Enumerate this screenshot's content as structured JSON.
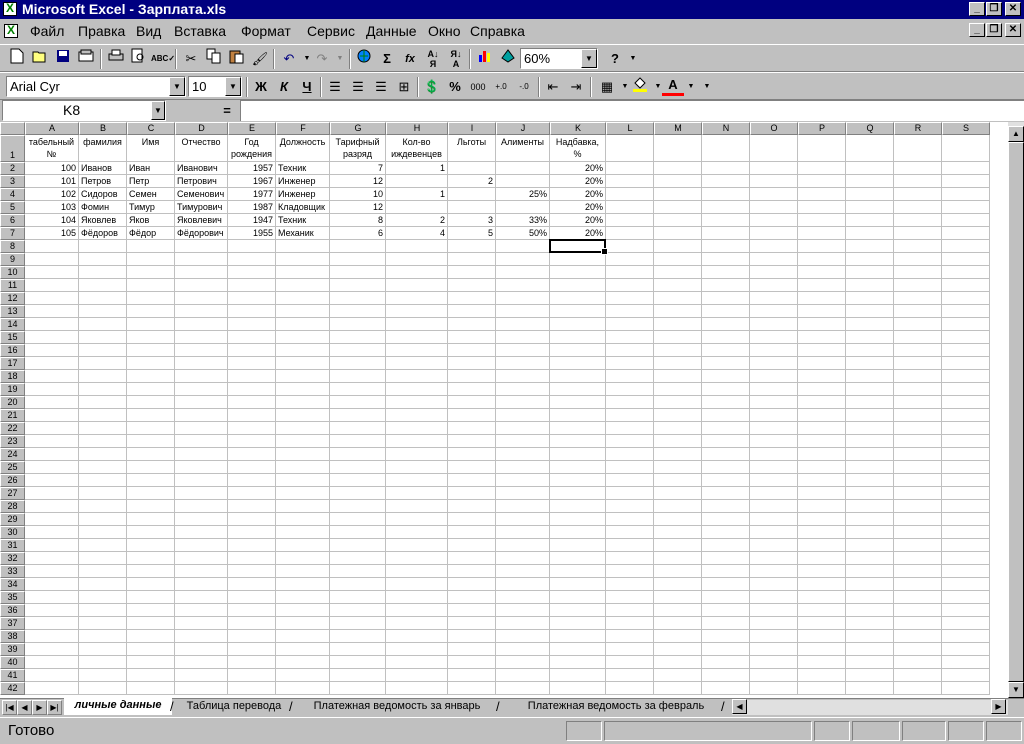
{
  "window": {
    "title": "Microsoft Excel - Зарплата.xls"
  },
  "menu": [
    "Файл",
    "Правка",
    "Вид",
    "Вставка",
    "Формат",
    "Сервис",
    "Данные",
    "Окно",
    "Справка"
  ],
  "toolbar_standard": {
    "zoom": "60%",
    "icons": [
      "new-icon",
      "open-icon",
      "save-icon",
      "print-icon",
      "print-preview-icon",
      "spelling-icon",
      "cut-icon",
      "copy-icon",
      "paste-icon",
      "format-painter-icon",
      "undo-icon",
      "redo-icon",
      "web-icon",
      "autosum-icon",
      "function-icon",
      "sort-asc-icon",
      "sort-desc-icon",
      "chart-wizard-icon",
      "drawing-icon",
      "help-icon"
    ],
    "autosum_glyph": "Σ",
    "function_glyph": "fx"
  },
  "toolbar_format": {
    "font": "Arial Cyr",
    "size": "10",
    "bold": "Ж",
    "italic": "К",
    "underline": "Ч",
    "percent": "%",
    "thousands": "000",
    "font_color_glyph": "A"
  },
  "formula_bar": {
    "cell_ref": "K8",
    "equals": "=",
    "content": ""
  },
  "grid": {
    "columns": [
      "A",
      "B",
      "C",
      "D",
      "E",
      "F",
      "G",
      "H",
      "I",
      "J",
      "K",
      "L",
      "M",
      "N",
      "O",
      "P",
      "Q",
      "R",
      "S"
    ],
    "header_row": [
      "табельный №",
      "фамилия",
      "Имя",
      "Отчество",
      "Год рождения",
      "Должность",
      "Тарифный разряд",
      "Кол-во иждевенцев",
      "Льготы",
      "Алименты",
      "Надбавка, %"
    ],
    "rows": [
      [
        "100",
        "Иванов",
        "Иван",
        "Иванович",
        "1957",
        "Техник",
        "7",
        "1",
        "",
        "",
        "20%"
      ],
      [
        "101",
        "Петров",
        "Петр",
        "Петрович",
        "1967",
        "Инженер",
        "12",
        "",
        "2",
        "",
        "20%"
      ],
      [
        "102",
        "Сидоров",
        "Семен",
        "Семенович",
        "1977",
        "Инженер",
        "10",
        "1",
        "",
        "25%",
        "20%"
      ],
      [
        "103",
        "Фомин",
        "Тимур",
        "Тимурович",
        "1987",
        "Кладовщик",
        "12",
        "",
        "",
        "",
        "20%"
      ],
      [
        "104",
        "Яковлев",
        "Яков",
        "Яковлевич",
        "1947",
        "Техник",
        "8",
        "2",
        "3",
        "33%",
        "20%"
      ],
      [
        "105",
        "Фёдоров",
        "Фёдор",
        "Фёдорович",
        "1955",
        "Механик",
        "6",
        "4",
        "5",
        "50%",
        "20%"
      ]
    ],
    "row_count": 42,
    "selected_cell": "K8"
  },
  "sheet_tabs": [
    "личные данные",
    "Таблица перевода",
    "Платежная ведомость за январь",
    "Платежная ведомость за  февраль"
  ],
  "active_tab": "личные данные",
  "status": "Готово"
}
